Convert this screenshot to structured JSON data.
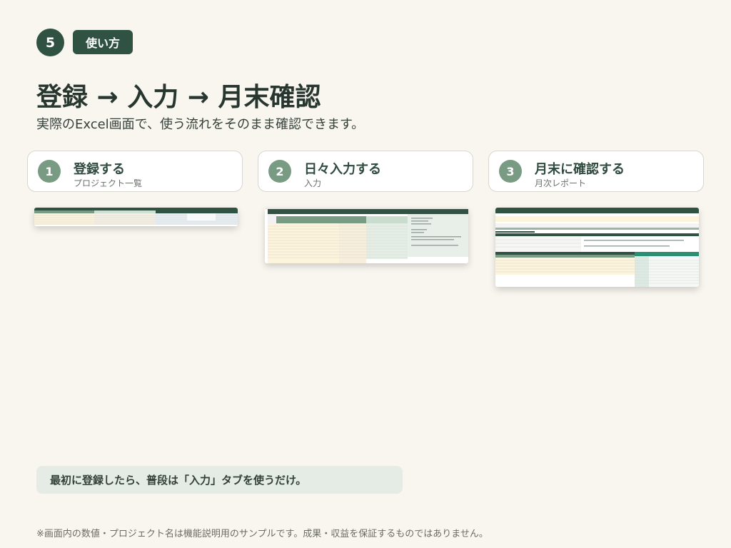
{
  "header": {
    "step_number": "5",
    "section_tag": "使い方",
    "title": "登録 → 入力 → 月末確認",
    "subtitle": "実際のExcel画面で、使う流れをそのまま確認できます。"
  },
  "steps": [
    {
      "number": "1",
      "title": "登録する",
      "subtitle": "プロジェクト一覧"
    },
    {
      "number": "2",
      "title": "日々入力する",
      "subtitle": "入力"
    },
    {
      "number": "3",
      "title": "月末に確認する",
      "subtitle": "月次レポート"
    }
  ],
  "note": "最初に登録したら、普段は「入力」タブを使うだけ。",
  "disclaimer": "※画面内の数値・プロジェクト名は機能説明用のサンプルです。成果・収益を保証するものではありません。",
  "colors": {
    "background": "#f9f6f0",
    "accent_dark": "#2f5242",
    "accent_soft": "#7a9b83",
    "note_bg": "#e5ece6"
  }
}
